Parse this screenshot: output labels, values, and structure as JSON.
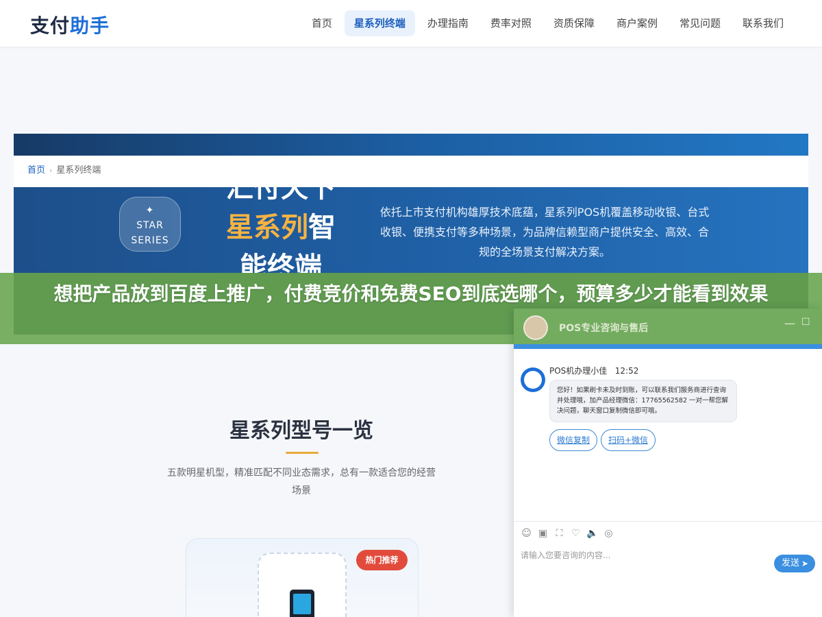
{
  "header": {
    "logo_part1": "支付",
    "logo_part2": "助手",
    "nav": [
      {
        "label": "首页"
      },
      {
        "label": "星系列终端",
        "active": true
      },
      {
        "label": "办理指南"
      },
      {
        "label": "费率对照"
      },
      {
        "label": "资质保障"
      },
      {
        "label": "商户案例"
      },
      {
        "label": "常见问题"
      },
      {
        "label": "联系我们"
      }
    ]
  },
  "breadcrumb": {
    "home": "首页",
    "separator": "›",
    "current": "星系列终端"
  },
  "hero": {
    "badge_icon": "✦",
    "badge_line1": "STAR",
    "badge_line2": "SERIES",
    "title_line1": "汇付天下",
    "title_accent": "星系列",
    "title_rest": "智",
    "title_line3": "能终端",
    "description": "依托上市支付机构雄厚技术底蕴，星系列POS机覆盖移动收银、台式收银、便携支付等多种场景，为品牌信赖型商户提供安全、高效、合规的全场景支付解决方案。"
  },
  "banner": {
    "title": "想把产品放到百度上推广，付费竞价和免费SEO到底选哪个，预算多少才能看到效果"
  },
  "models": {
    "title": "星系列型号一览",
    "subtitle": "五款明星机型，精准匹配不同业态需求，总有一款适合您的经营场景",
    "card_badge": "热门推荐"
  },
  "chat": {
    "header_title": "POS专业咨询与售后",
    "minimize_icon": "—",
    "maximize_icon": "☐",
    "agent_name": "POS机办理小佳",
    "time": "12:52",
    "message": "您好！如果刷卡未及时到账，可以联系我们服务商进行查询并处理哦，加产品经理微信：17765562582 一对一帮您解决问题，聊天窗口复制微信即可哦。",
    "quick_buttons": [
      "微信复制",
      "扫码+微信"
    ],
    "input_placeholder": "请输入您要咨询的内容...",
    "send_label": "发送",
    "tool_icons": [
      "☺",
      "▣",
      "⛶",
      "♡",
      "🔈",
      "◎"
    ]
  },
  "colors": {
    "brand_blue": "#1d6fd8",
    "accent_orange": "#f5b342",
    "banner_green": "#6ca856",
    "hot_red": "#e24b3b"
  }
}
